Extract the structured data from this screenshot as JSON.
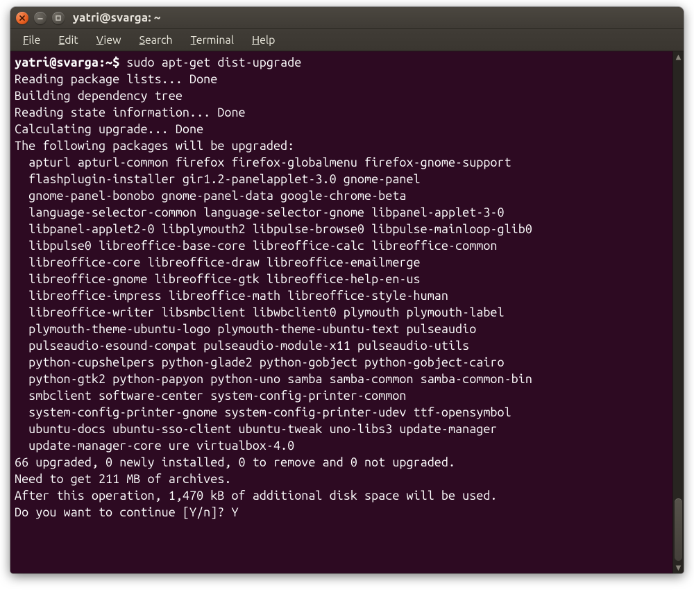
{
  "window": {
    "title": "yatri@svarga: ~"
  },
  "menubar": {
    "items": [
      {
        "label": "File",
        "accel": "F"
      },
      {
        "label": "Edit",
        "accel": "E"
      },
      {
        "label": "View",
        "accel": "V"
      },
      {
        "label": "Search",
        "accel": "S"
      },
      {
        "label": "Terminal",
        "accel": "T"
      },
      {
        "label": "Help",
        "accel": "H"
      }
    ]
  },
  "terminal": {
    "prompt": "yatri@svarga:~$ ",
    "command": "sudo apt-get dist-upgrade",
    "preamble": [
      "Reading package lists... Done",
      "Building dependency tree",
      "Reading state information... Done",
      "Calculating upgrade... Done",
      "The following packages will be upgraded:"
    ],
    "package_lines": [
      "apturl apturl-common firefox firefox-globalmenu firefox-gnome-support",
      "flashplugin-installer gir1.2-panelapplet-3.0 gnome-panel",
      "gnome-panel-bonobo gnome-panel-data google-chrome-beta",
      "language-selector-common language-selector-gnome libpanel-applet-3-0",
      "libpanel-applet2-0 libplymouth2 libpulse-browse0 libpulse-mainloop-glib0",
      "libpulse0 libreoffice-base-core libreoffice-calc libreoffice-common",
      "libreoffice-core libreoffice-draw libreoffice-emailmerge",
      "libreoffice-gnome libreoffice-gtk libreoffice-help-en-us",
      "libreoffice-impress libreoffice-math libreoffice-style-human",
      "libreoffice-writer libsmbclient libwbclient0 plymouth plymouth-label",
      "plymouth-theme-ubuntu-logo plymouth-theme-ubuntu-text pulseaudio",
      "pulseaudio-esound-compat pulseaudio-module-x11 pulseaudio-utils",
      "python-cupshelpers python-glade2 python-gobject python-gobject-cairo",
      "python-gtk2 python-papyon python-uno samba samba-common samba-common-bin",
      "smbclient software-center system-config-printer-common",
      "system-config-printer-gnome system-config-printer-udev ttf-opensymbol",
      "ubuntu-docs ubuntu-sso-client ubuntu-tweak uno-libs3 update-manager",
      "update-manager-core ure virtualbox-4.0"
    ],
    "summary": [
      "66 upgraded, 0 newly installed, 0 to remove and 0 not upgraded.",
      "Need to get 211 MB of archives.",
      "After this operation, 1,470 kB of additional disk space will be used."
    ],
    "confirm_prompt": "Do you want to continue [Y/n]? ",
    "confirm_input": "Y"
  },
  "colors": {
    "terminal_bg": "#2d0a22",
    "terminal_fg": "#ffffff",
    "chrome_dark": "#3c3933",
    "close_btn": "#e55e20"
  }
}
